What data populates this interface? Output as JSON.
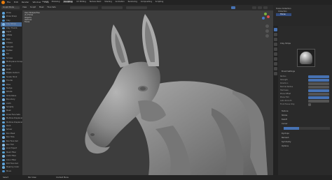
{
  "topbar": {
    "menu_items": [
      "File",
      "Edit",
      "Render",
      "Window",
      "Help"
    ],
    "workspace_tabs": [
      "Layout",
      "Modeling",
      "Sculpting",
      "UV Editing",
      "Texture Paint",
      "Shading",
      "Animation",
      "Rendering",
      "Compositing",
      "Scripting"
    ],
    "active_tab": "Sculpting"
  },
  "tool_header": {
    "mode_label": "Sculpt Mode",
    "menus": [
      "View",
      "Sculpt",
      "Mask",
      "Face Sets"
    ]
  },
  "viewport": {
    "overlay_lines": [
      "User Perspective",
      "(1) Horse",
      "Objects",
      "Vertices",
      "Faces"
    ]
  },
  "tools": [
    "Draw",
    "Draw Sharp",
    "Clay",
    "Clay Strips",
    "Clay Thumb",
    "Layer",
    "Inflate",
    "Blob",
    "Crease",
    "Smooth",
    "Flatten",
    "Fill",
    "Scrape",
    "Multi-plane Scrape",
    "Pinch",
    "Grab",
    "Elastic Deform",
    "Snake Hook",
    "Thumb",
    "Pose",
    "Nudge",
    "Rotate",
    "Slide Relax",
    "Boundary",
    "Cloth",
    "Simplify",
    "Mask",
    "Draw Face Sets",
    "Multires Displacement Eraser",
    "Multires Displacement Smear",
    "Paint",
    "Smear",
    "Box Mask",
    "Box Hide",
    "Box Face Set",
    "Box Trim",
    "Line Project",
    "Mesh Filter",
    "Cloth Filter",
    "Color Filter",
    "Edit Face Set",
    "Mask by Color",
    "Move"
  ],
  "active_tool_index": 3,
  "colors": {
    "accent": "#4772b3",
    "viewport_bg": "#3d3d3d",
    "mesh": "#9a9a9a"
  },
  "outliner": {
    "items": [
      "Scene Collection",
      "Collection",
      "Horse"
    ]
  },
  "properties": {
    "brush_name": "Clay Strips",
    "sections": [
      "Brush Settings",
      "Texture",
      "Stroke",
      "Falloff",
      "Cursor",
      "Dyntopo",
      "Remesh",
      "Symmetry",
      "Options"
    ],
    "fields": [
      "Radius",
      "Strength",
      "Direction",
      "Normal Radius",
      "Hardness",
      "Plane Offset",
      "Plane Trim",
      "Auto-Smooth",
      "Front Faces Only"
    ]
  },
  "statusbar": {
    "left": "Select",
    "mid": "Pan View",
    "right": "Context Menu"
  }
}
